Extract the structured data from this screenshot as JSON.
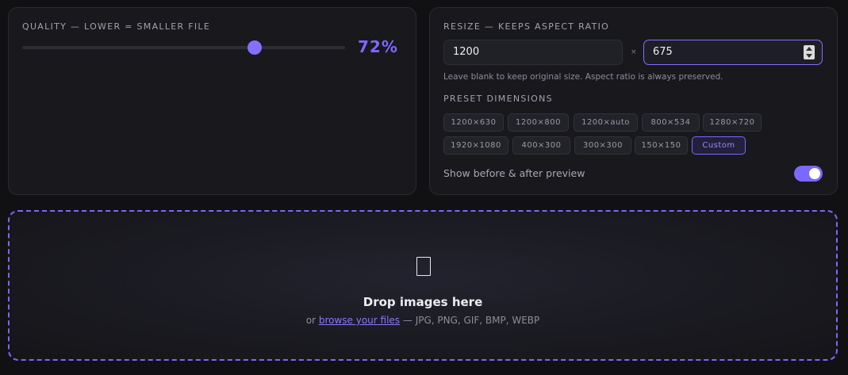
{
  "quality": {
    "label": "QUALITY — LOWER = SMALLER FILE",
    "value_percent": 72,
    "value_label": "72%"
  },
  "resize": {
    "label": "RESIZE — KEEPS ASPECT RATIO",
    "width_value": "1200",
    "separator": "×",
    "height_value": "675",
    "hint": "Leave blank to keep original size. Aspect ratio is always preserved.",
    "preset_label": "PRESET DIMENSIONS",
    "presets": [
      "1200×630",
      "1200×800",
      "1200×auto",
      "800×534",
      "1280×720",
      "1920×1080",
      "400×300",
      "300×300",
      "150×150",
      "Custom"
    ],
    "active_preset": "Custom",
    "preview_toggle_label": "Show before & after preview",
    "preview_toggle_on": true
  },
  "dropzone": {
    "icon": "file-icon",
    "title": "Drop images here",
    "sub_prefix": "or",
    "browse_link": "browse your files",
    "sub_suffix": "— JPG, PNG, GIF, BMP, WEBP"
  },
  "colors": {
    "accent": "#7b68ff",
    "background": "#111114",
    "card": "#18181d"
  }
}
